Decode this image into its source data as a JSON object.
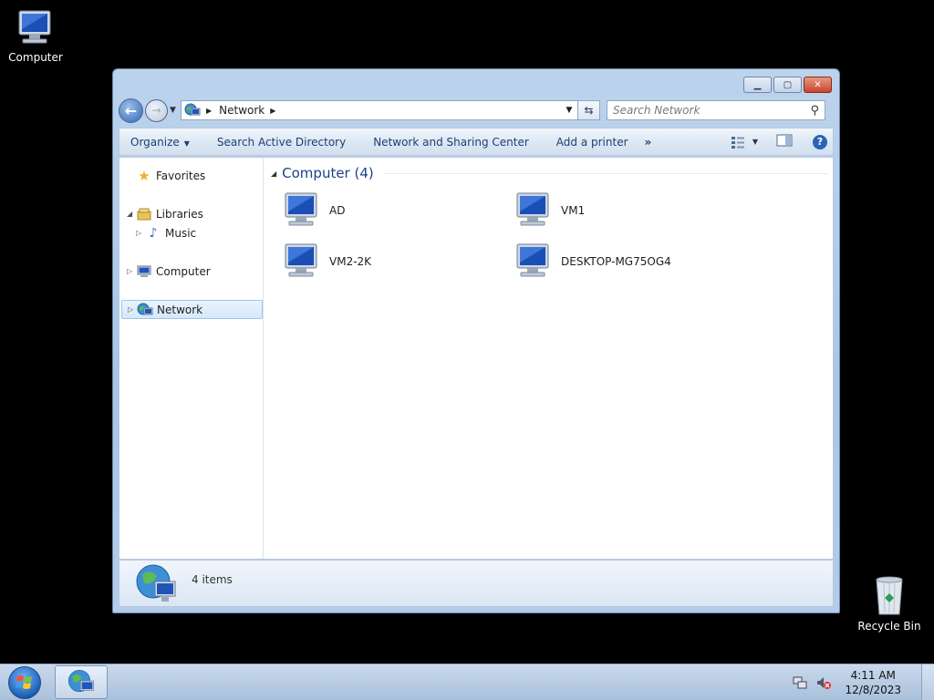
{
  "desktop": {
    "icons": [
      {
        "label": "Computer"
      },
      {
        "label": "Recycle Bin"
      }
    ]
  },
  "window": {
    "address": {
      "crumbs": [
        "Network"
      ]
    },
    "search": {
      "placeholder": "Search Network"
    },
    "toolbar": {
      "organize": "Organize",
      "search_ad": "Search Active Directory",
      "network_sharing": "Network and Sharing Center",
      "add_printer": "Add a printer",
      "more": "»"
    },
    "nav_pane": {
      "favorites": "Favorites",
      "libraries": "Libraries",
      "music": "Music",
      "computer": "Computer",
      "network": "Network"
    },
    "content": {
      "group_title": "Computer (4)",
      "items": [
        {
          "label": "AD"
        },
        {
          "label": "VM1"
        },
        {
          "label": "VM2-2K"
        },
        {
          "label": "DESKTOP-MG75OG4"
        }
      ]
    },
    "details": {
      "count": "4 items"
    }
  },
  "taskbar": {
    "time": "4:11 AM",
    "date": "12/8/2023"
  },
  "colors": {
    "desktop_bg": "#000000",
    "accent": "#1e3f8a",
    "close_button": "#c7452b"
  },
  "icon_names": [
    "computer-icon",
    "recycle-bin-icon",
    "network-icon",
    "star-icon",
    "library-icon",
    "music-icon",
    "help-icon",
    "windows-orb-icon",
    "network-tray-icon",
    "volume-muted-icon"
  ]
}
